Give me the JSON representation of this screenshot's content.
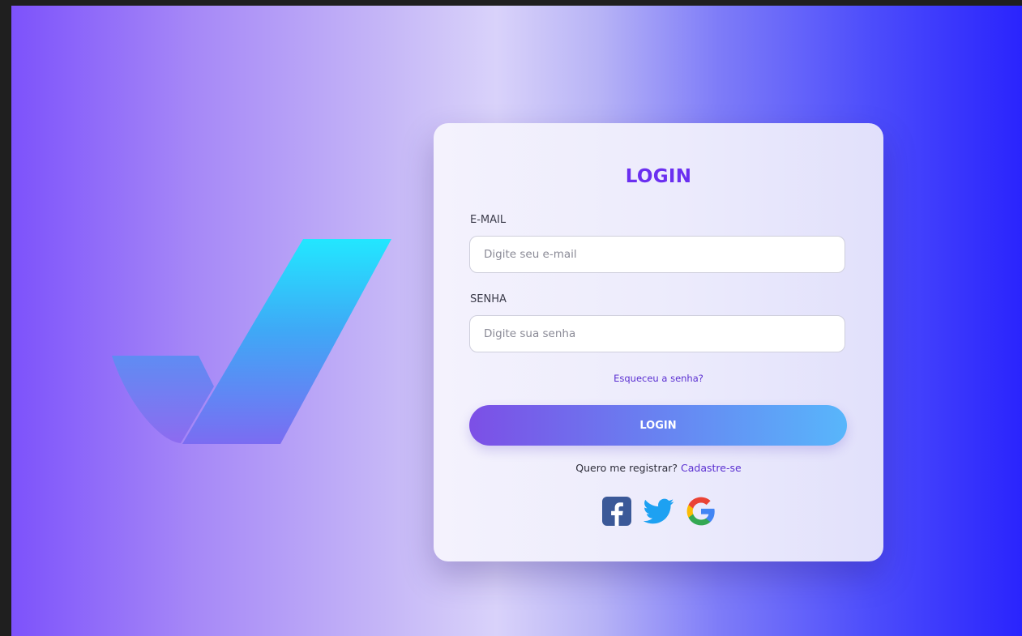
{
  "login_form": {
    "title": "LOGIN",
    "email_label": "E-MAIL",
    "email_placeholder": "Digite seu e-mail",
    "password_label": "SENHA",
    "password_placeholder": "Digite sua senha",
    "forgot_password": "Esqueceu a senha?",
    "login_button": "LOGIN",
    "register_prompt": "Quero me registrar?",
    "register_link": "Cadastre-se"
  },
  "social_login": [
    {
      "name": "facebook-icon",
      "color": "#3b5998"
    },
    {
      "name": "twitter-icon",
      "color": "#1da1f2"
    },
    {
      "name": "google-icon",
      "colors": [
        "#4285f4",
        "#34a853",
        "#fbbc05",
        "#ea4335"
      ]
    }
  ],
  "colors": {
    "accent": "#6b2ff0",
    "link": "#5a2fd1",
    "button_gradient": [
      "#7c4fe6",
      "#58b6fb"
    ],
    "background_gradient": [
      "#7d52fb",
      "#d9d2fa",
      "#2a24fd"
    ]
  },
  "logo": {
    "name": "checkmark-logo"
  }
}
